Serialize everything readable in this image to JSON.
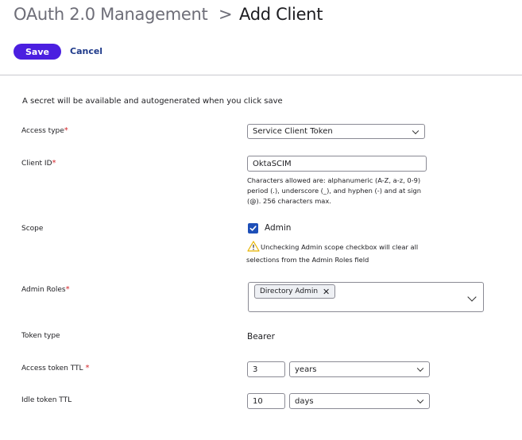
{
  "header": {
    "breadcrumb_parent": "OAuth 2.0 Management",
    "separator": ">",
    "title": "Add Client"
  },
  "toolbar": {
    "save_label": "Save",
    "cancel_label": "Cancel"
  },
  "form": {
    "info_text": "A secret will be available and autogenerated when you click save",
    "access_type": {
      "label": "Access type",
      "required": "*",
      "value": "Service Client Token"
    },
    "client_id": {
      "label": "Client ID",
      "required": "*",
      "value": "OktaSCIM",
      "helper": "Characters allowed are: alphanumeric (A-Z, a-z, 0-9) period (.), underscore (_), and hyphen (-) and at sign (@). 256 characters max."
    },
    "scope": {
      "label": "Scope",
      "checkbox_label": "Admin",
      "checked": true,
      "warning": "Unchecking Admin scope checkbox will clear all selections from the Admin Roles field"
    },
    "admin_roles": {
      "label": "Admin Roles",
      "required": "*",
      "tags": [
        "Directory Admin"
      ],
      "remove_glyph": "✕"
    },
    "token_type": {
      "label": "Token type",
      "value": "Bearer"
    },
    "access_token_ttl": {
      "label": "Access token TTL",
      "required": "*",
      "value": "3",
      "unit": "years"
    },
    "idle_token_ttl": {
      "label": "Idle token TTL",
      "value": "10",
      "unit": "days"
    }
  },
  "colors": {
    "primary": "#4b1fe0",
    "link": "#1f3a8a",
    "required": "#d3262b",
    "checkbox": "#1e4fb8",
    "warning": "#e8b500"
  },
  "icons": {
    "warning": "warning-triangle-icon",
    "check": "checkmark-icon",
    "chevron": "chevron-down-icon",
    "remove": "close-icon"
  }
}
